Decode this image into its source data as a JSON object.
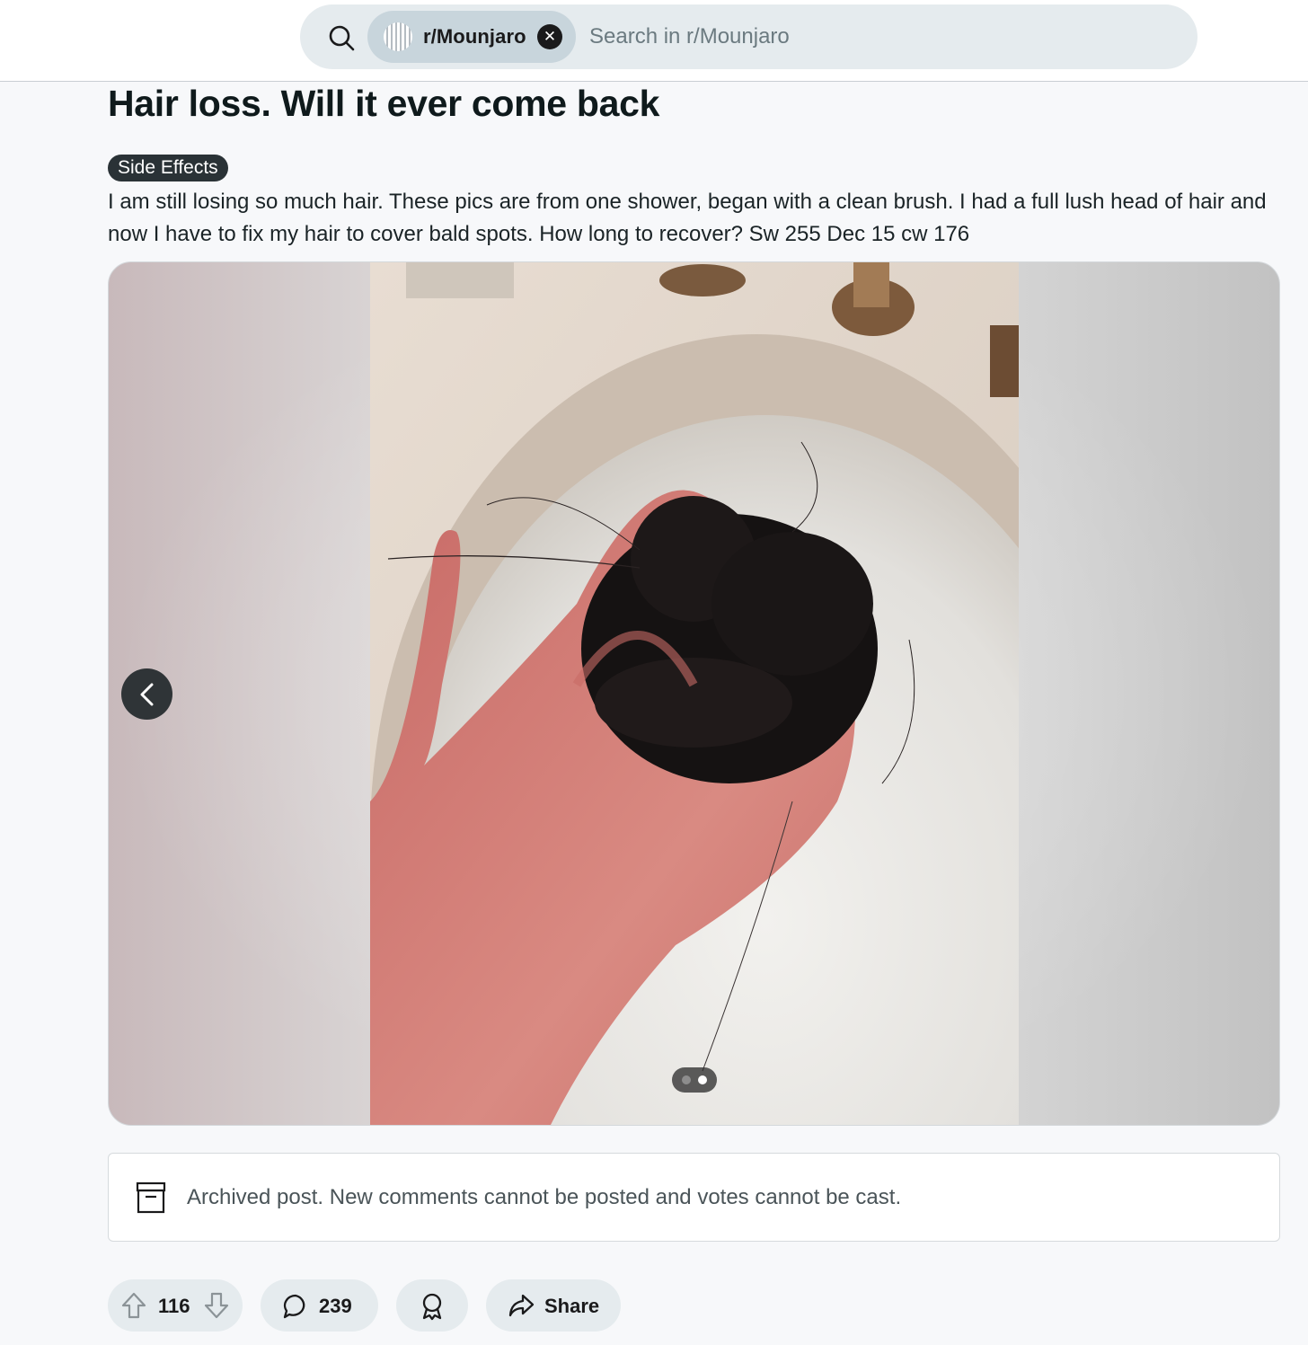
{
  "header": {
    "subreddit_chip": "r/Mounjaro",
    "search_placeholder": "Search in r/Mounjaro"
  },
  "post": {
    "title": "Hair loss. Will it ever come back",
    "flair": "Side Effects",
    "body": "I am still losing so much hair. These pics are from one shower, began with a clean brush. I had a full lush head of hair and now I have to fix my hair to cover bald spots. How long to recover? Sw 255 Dec 15 cw 176"
  },
  "gallery": {
    "image_count": 2,
    "current_index": 2
  },
  "archived_notice": "Archived post. New comments cannot be posted and votes cannot be cast.",
  "actions": {
    "vote_count": "116",
    "comment_count": "239",
    "share_label": "Share"
  },
  "colors": {
    "pill_bg": "#e5ebee",
    "flair_bg": "#2a3236",
    "page_bg": "#f7f8fa"
  }
}
